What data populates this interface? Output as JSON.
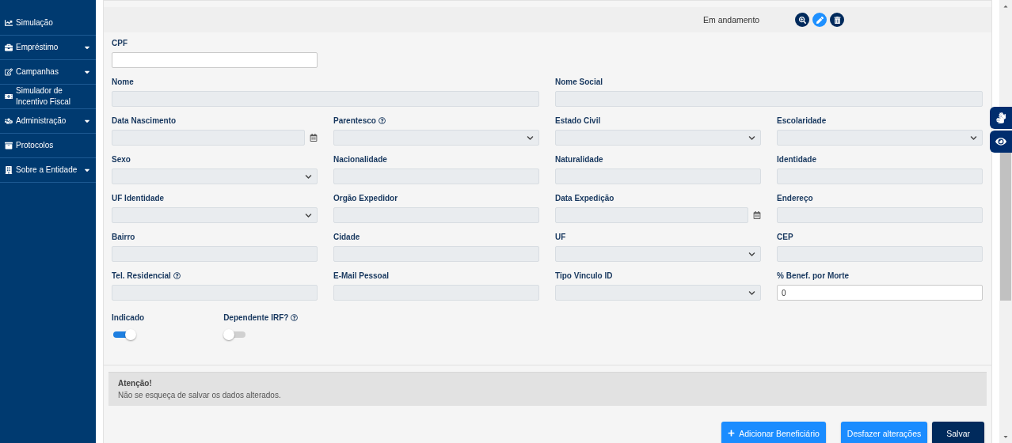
{
  "sidebar": {
    "items": [
      {
        "label": "Simulação",
        "caret": false
      },
      {
        "label": "Empréstimo",
        "caret": true
      },
      {
        "label": "Campanhas",
        "caret": true
      },
      {
        "label": "Simulador de Incentivo Fiscal",
        "caret": false
      },
      {
        "label": "Administração",
        "caret": true
      },
      {
        "label": "Protocolos",
        "caret": false
      },
      {
        "label": "Sobre a Entidade",
        "caret": true
      }
    ]
  },
  "record": {
    "status": "Em andamento",
    "actions": [
      {
        "kind": "view"
      },
      {
        "kind": "edit"
      },
      {
        "kind": "delete"
      }
    ]
  },
  "form": {
    "cpf": {
      "label": "CPF",
      "kind": "text",
      "disabled": false,
      "help": false
    },
    "names": [
      {
        "label": "Nome",
        "kind": "text",
        "disabled": true,
        "help": false
      },
      {
        "label": "Nome Social",
        "kind": "text",
        "disabled": true,
        "help": false
      }
    ],
    "fields": [
      {
        "label": "Data Nascimento",
        "kind": "date",
        "disabled": true,
        "help": false
      },
      {
        "label": "Parentesco",
        "kind": "select",
        "disabled": true,
        "help": true
      },
      {
        "label": "Estado Civil",
        "kind": "select",
        "disabled": true,
        "help": false
      },
      {
        "label": "Escolaridade",
        "kind": "select",
        "disabled": true,
        "help": false
      },
      {
        "label": "Sexo",
        "kind": "select",
        "disabled": true,
        "help": false
      },
      {
        "label": "Nacionalidade",
        "kind": "text",
        "disabled": true,
        "help": false
      },
      {
        "label": "Naturalidade",
        "kind": "text",
        "disabled": true,
        "help": false
      },
      {
        "label": "Identidade",
        "kind": "text",
        "disabled": true,
        "help": false
      },
      {
        "label": "UF Identidade",
        "kind": "select",
        "disabled": true,
        "help": false
      },
      {
        "label": "Orgão Expedidor",
        "kind": "text",
        "disabled": true,
        "help": false
      },
      {
        "label": "Data Expedição",
        "kind": "date",
        "disabled": true,
        "help": false
      },
      {
        "label": "Endereço",
        "kind": "text",
        "disabled": true,
        "help": false
      },
      {
        "label": "Bairro",
        "kind": "text",
        "disabled": true,
        "help": false
      },
      {
        "label": "Cidade",
        "kind": "text",
        "disabled": true,
        "help": false
      },
      {
        "label": "UF",
        "kind": "select",
        "disabled": true,
        "help": false
      },
      {
        "label": "CEP",
        "kind": "text",
        "disabled": true,
        "help": false
      },
      {
        "label": "Tel. Residencial",
        "kind": "text",
        "disabled": true,
        "help": true
      },
      {
        "label": "E-Mail Pessoal",
        "kind": "text",
        "disabled": true,
        "help": false
      },
      {
        "label": "Tipo Vinculo ID",
        "kind": "select",
        "disabled": true,
        "help": false
      },
      {
        "label": "% Benef. por Morte",
        "kind": "text",
        "disabled": false,
        "help": false,
        "value": "0"
      }
    ],
    "toggles": [
      {
        "label": "Indicado",
        "on": true,
        "help": false
      },
      {
        "label": "Dependente IRF?",
        "on": false,
        "help": true
      }
    ]
  },
  "alert": {
    "title": "Atenção!",
    "message": "Não se esqueça de salvar os dados alterados."
  },
  "buttons": [
    {
      "label": "Adicionar Beneficiário",
      "kind": "add"
    },
    {
      "label": "Desfazer alterações",
      "kind": "secondary"
    },
    {
      "label": "Salvar",
      "kind": "primary"
    }
  ]
}
